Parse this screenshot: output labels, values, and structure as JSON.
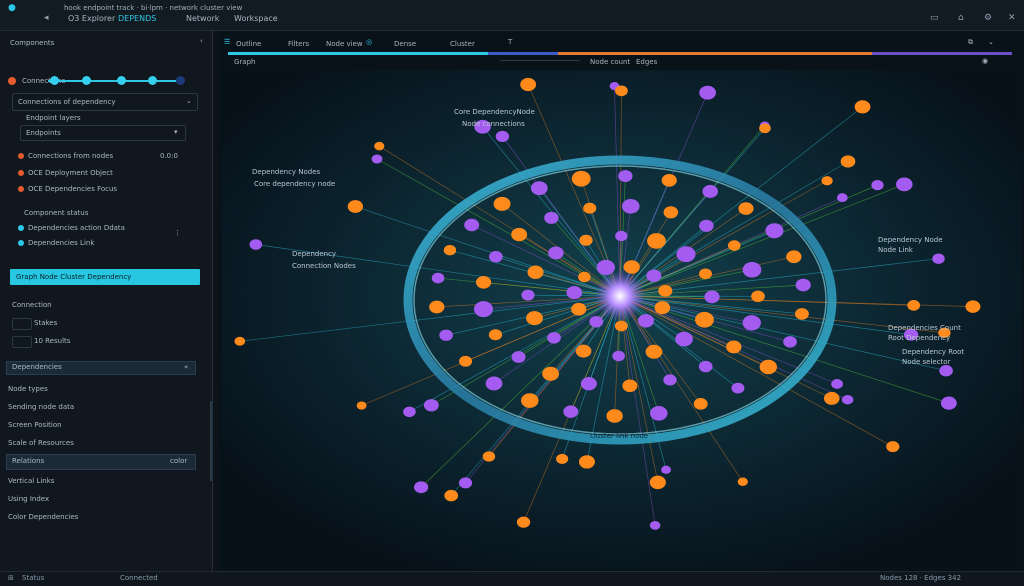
{
  "titlebar": {
    "top_text": "hook endpoint track · bi·lpm · network cluster view",
    "tabs": [
      {
        "label": "O3 Explorer"
      },
      {
        "label": "DEPENDS"
      },
      {
        "label": "Network"
      },
      {
        "label": "Workspace"
      }
    ]
  },
  "sidebar": {
    "header": "Components",
    "section": "Connections",
    "items": [
      {
        "label": "Connections of dependency"
      },
      {
        "label": "Endpoint layers"
      },
      {
        "label": "Endpoints"
      },
      {
        "label": "Connections from nodes",
        "value": "0.0:0"
      },
      {
        "label": "OCE Deployment Object"
      },
      {
        "label": "OCE Dependencies Focus"
      },
      {
        "label": "Component status"
      },
      {
        "label": "Dependencies action Ddata"
      },
      {
        "label": "Dependencies Link"
      }
    ],
    "highlight_bar": "Graph Node Cluster Dependency",
    "group_label": "Connection",
    "filter": "Stakes",
    "count": "10 Results",
    "selected_section": "Dependencies",
    "list": [
      {
        "label": "Node types"
      },
      {
        "label": "Sending node data"
      },
      {
        "label": "Screen Position"
      },
      {
        "label": "Scale of Resources"
      }
    ],
    "selected_row": {
      "label": "Relations",
      "value": "color"
    },
    "bottom_list": [
      {
        "label": "Vertical Links"
      },
      {
        "label": "Using Index"
      },
      {
        "label": "Color Dependencies"
      }
    ]
  },
  "toolbar": {
    "items": [
      {
        "label": "Outline"
      },
      {
        "label": "Filters"
      },
      {
        "label": "Node view"
      },
      {
        "label": "Dense"
      },
      {
        "label": "Cluster"
      }
    ],
    "second_row": {
      "left": "Graph",
      "center": "Node count",
      "right": "Edges"
    },
    "progress_colors": [
      "#2ec7e6",
      "#3d5cc7",
      "#e57b2e",
      "#6b4fc7"
    ]
  },
  "viz": {
    "labels": [
      {
        "text": "Core DependencyNode"
      },
      {
        "text": "Node connections"
      },
      {
        "text": "Dependency Nodes"
      },
      {
        "text": "Core dependency node"
      },
      {
        "text": "Dependency"
      },
      {
        "text": "Connection Nodes"
      },
      {
        "text": "Dependency Node"
      },
      {
        "text": "Node Link"
      },
      {
        "text": "Dependencies Count"
      },
      {
        "text": "Root Dependency"
      },
      {
        "text": "Dependency Root"
      },
      {
        "text": "Node selector"
      },
      {
        "text": "cluster link node"
      }
    ]
  },
  "statusbar": {
    "left": "Status",
    "center": "Connected",
    "right": "Nodes 128 · Edges 342"
  },
  "colors": {
    "accent": "#2ec7e6",
    "orange": "#ff8a1c",
    "green": "#62e33a",
    "purple": "#a45cf0",
    "cyan": "#34d6f4",
    "highlight": "#27c7e2"
  }
}
